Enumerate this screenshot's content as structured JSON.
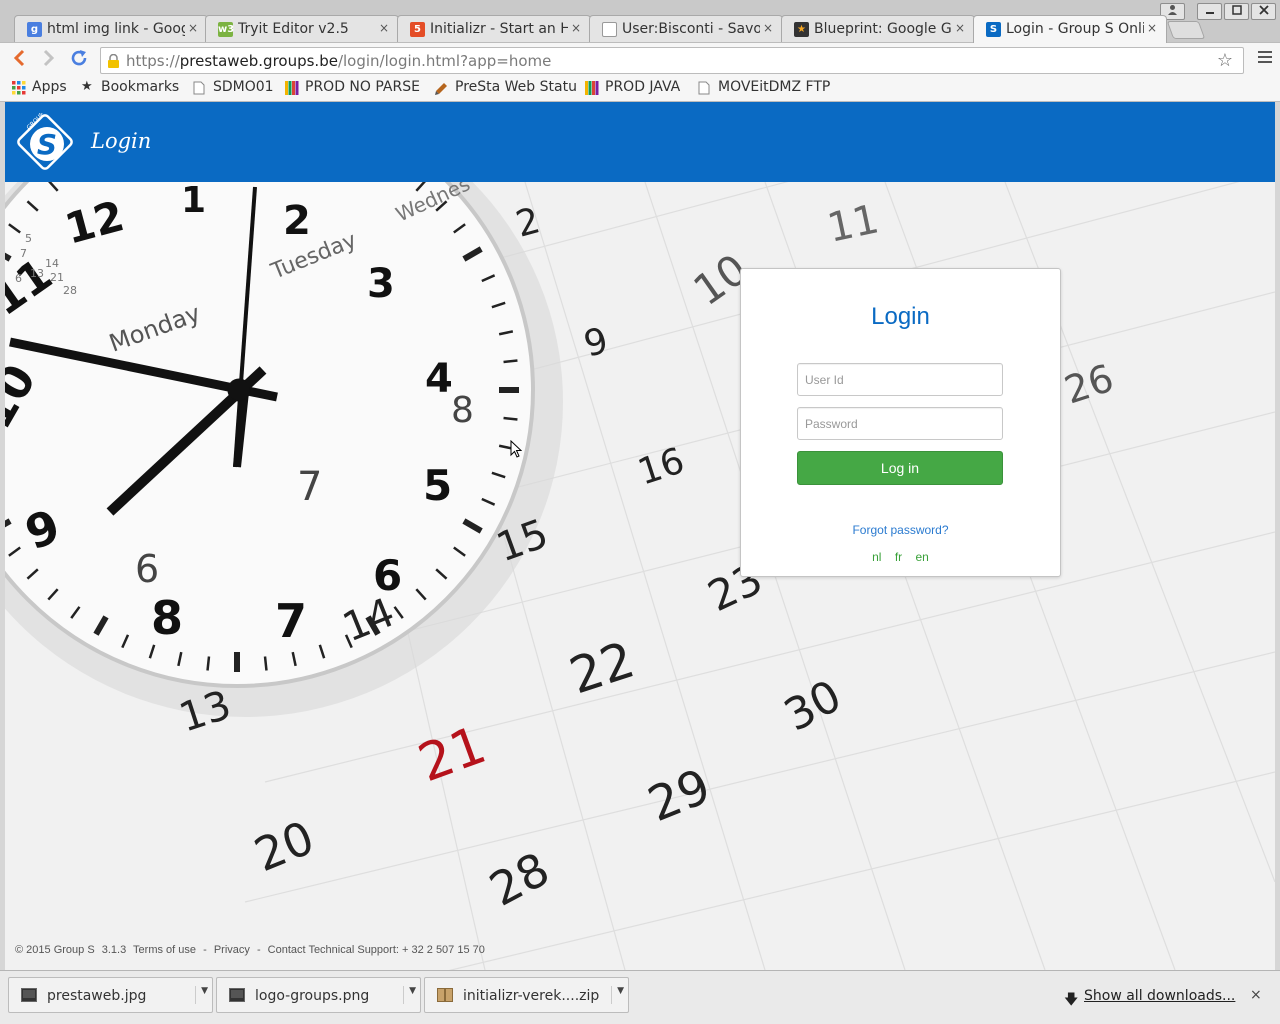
{
  "browser": {
    "tabs": [
      {
        "title": "html img link - Goog",
        "favicon": "google-icon",
        "active": false
      },
      {
        "title": "Tryit Editor v2.5",
        "favicon": "w3schools-icon",
        "active": false
      },
      {
        "title": "Initializr - Start an H",
        "favicon": "html5-icon",
        "active": false
      },
      {
        "title": "User:Bisconti - Savoi",
        "favicon": "page-icon",
        "active": false
      },
      {
        "title": "Blueprint: Google Gr",
        "favicon": "star-icon",
        "active": false
      },
      {
        "title": "Login - Group S Onli",
        "favicon": "groups-icon",
        "active": true
      }
    ],
    "close_glyph": "×",
    "url": {
      "scheme": "https://",
      "host": "prestaweb.groups.be",
      "path": "/login/login.html?app=home"
    },
    "bookmarks": [
      {
        "label": "Apps",
        "icon": "apps-grid-icon"
      },
      {
        "label": "Bookmarks",
        "icon": "bookmark-star-icon"
      },
      {
        "label": "SDMO01",
        "icon": "page-icon"
      },
      {
        "label": "PROD NO PARSE",
        "icon": "colorbars-icon"
      },
      {
        "label": "PreSta Web Statu",
        "icon": "pencil-icon"
      },
      {
        "label": "PROD JAVA",
        "icon": "colorbars-icon"
      },
      {
        "label": "MOVEitDMZ FTP",
        "icon": "page-icon"
      }
    ],
    "downloads": [
      {
        "filename": "prestaweb.jpg",
        "icon": "image-file-icon"
      },
      {
        "filename": "logo-groups.png",
        "icon": "image-file-icon"
      },
      {
        "filename": "initializr-verek....zip",
        "icon": "archive-file-icon"
      }
    ],
    "show_all_downloads": "Show all downloads...",
    "colors": {
      "tab_bg": "#e4e4e4",
      "toolbar_bg": "#f6f6f6",
      "nav_accent": "#e56a2e"
    }
  },
  "header": {
    "title": "Login",
    "logo_text": "GROUP S",
    "color": "#0a6ac3"
  },
  "login": {
    "heading": "Login",
    "user_placeholder": "User Id",
    "password_placeholder": "Password",
    "button": "Log in",
    "forgot": "Forgot password?",
    "languages": [
      "nl",
      "fr",
      "en"
    ],
    "button_color": "#45a845"
  },
  "background": {
    "clock_day_labels": [
      "Monday",
      "Tuesday",
      "Wednes"
    ],
    "clock_hour_numbers": [
      "1",
      "2",
      "3",
      "4",
      "5",
      "6",
      "7",
      "8",
      "9",
      "10",
      "11",
      "12"
    ],
    "clock_inner_numbers": [
      "7",
      "8",
      "6"
    ],
    "calendar_numbers": [
      "2",
      "9",
      "16",
      "15",
      "14",
      "13",
      "22",
      "23",
      "21",
      "20",
      "29",
      "30",
      "28",
      "26",
      "11",
      "10"
    ],
    "small_calendar_numbers": [
      "5",
      "7",
      "14",
      "21",
      "28",
      "6",
      "13"
    ]
  },
  "footer": {
    "copyright": "© 2015 Group S",
    "version": "3.1.3",
    "terms": "Terms of use",
    "privacy": "Privacy",
    "separator": "-",
    "support": "Contact Technical Support: + 32 2 507 15 70"
  }
}
